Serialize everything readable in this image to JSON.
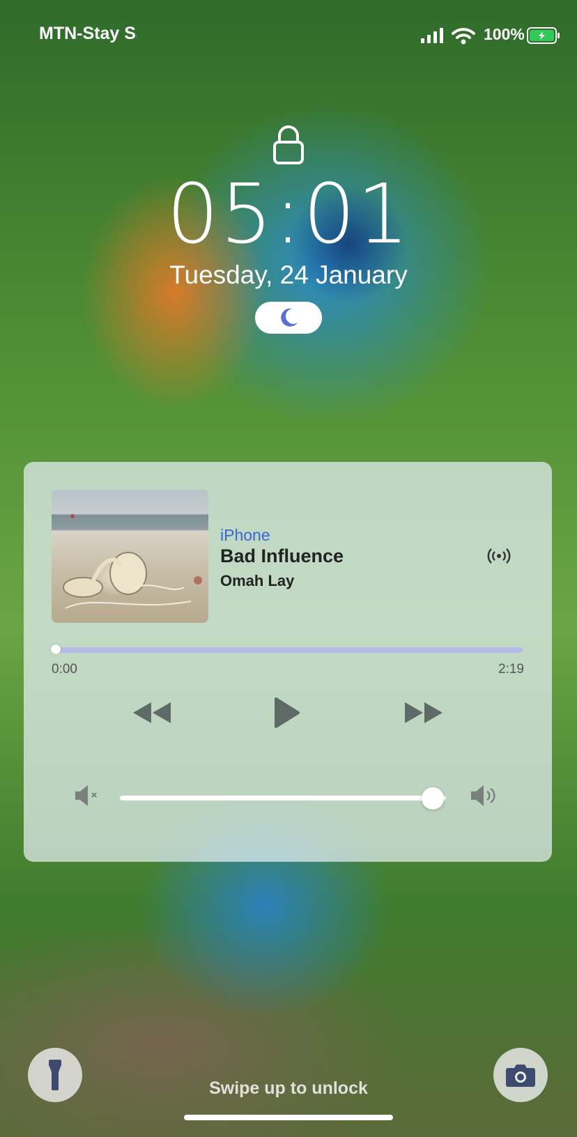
{
  "status_bar": {
    "carrier": "MTN-Stay Safe",
    "battery_percent": "100%",
    "battery_level": 1.0,
    "signal_bars": 4,
    "wifi_icon": "wifi-icon",
    "charging": true
  },
  "lock_screen": {
    "lock_icon": "lock-icon",
    "time": "05:01",
    "date": "Tuesday, 24 January",
    "focus_icon": "moon-icon",
    "swipe_hint": "Swipe up to unlock"
  },
  "now_playing": {
    "source": "iPhone",
    "title": "Bad Influence",
    "artist": "Omah Lay",
    "elapsed": "0:00",
    "remaining": "2:19",
    "progress_fraction": 0.0,
    "volume_fraction": 0.96,
    "controls": [
      "rewind-icon",
      "play-icon",
      "fast-forward-icon"
    ],
    "airplay_icon": "airplay-icon",
    "volume_icons": [
      "volume-mute-icon",
      "volume-up-icon"
    ]
  },
  "quick_actions": [
    "flashlight-icon",
    "camera-icon"
  ],
  "colors": {
    "accent_blue": "#3a66d6",
    "progress_track": "#b5bbe9",
    "battery_green": "#34c759",
    "moon": "#5b6fd6"
  }
}
